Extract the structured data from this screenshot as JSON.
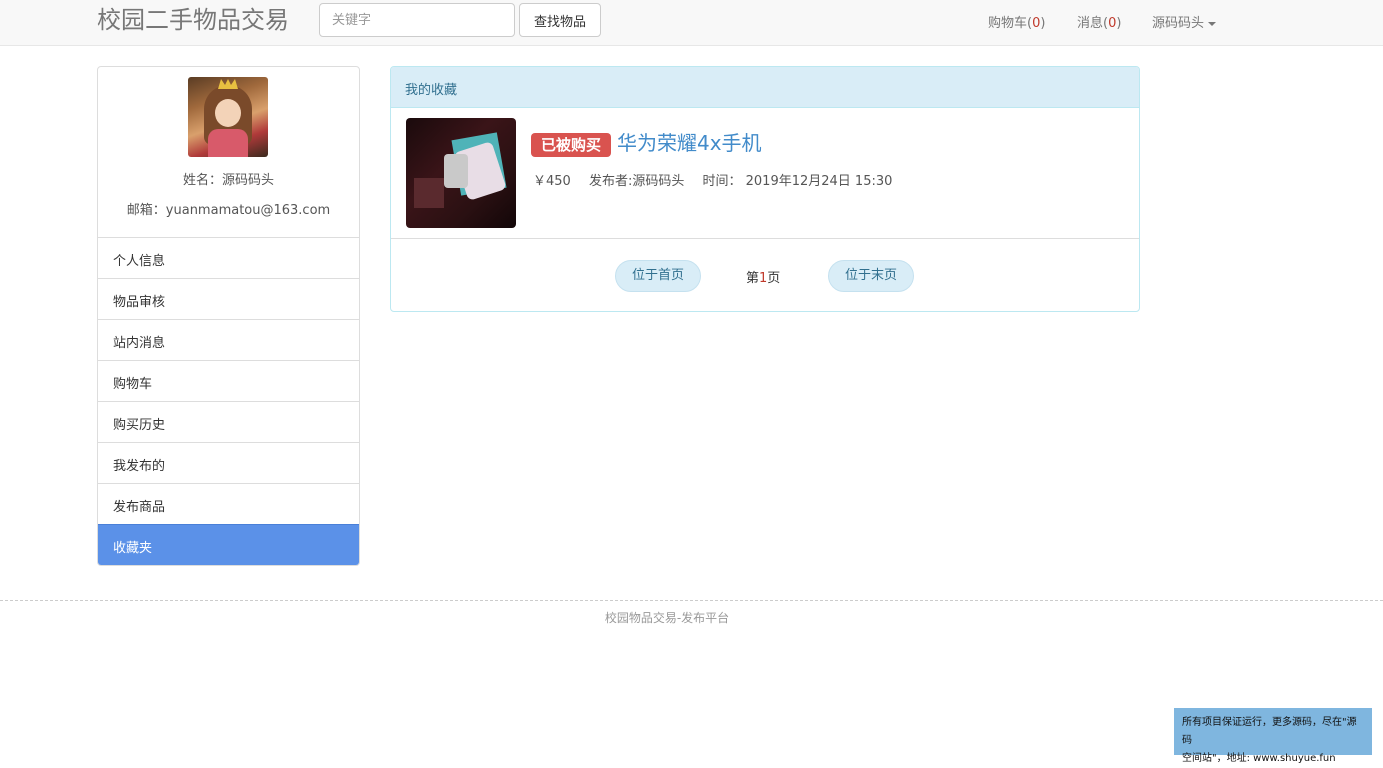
{
  "header": {
    "brand": "校园二手物品交易",
    "search_placeholder": "关键字",
    "search_button": "查找物品",
    "cart_label": "购物车(",
    "cart_count": "0",
    "cart_close": ")",
    "messages_label": "消息(",
    "messages_count": "0",
    "messages_close": ")",
    "user_menu": "源码码头"
  },
  "profile": {
    "name_line": "姓名：源码码头",
    "email_line": "邮箱：yuanmamatou@163.com"
  },
  "sidebar": {
    "items": [
      {
        "label": "个人信息"
      },
      {
        "label": "物品审核"
      },
      {
        "label": "站内消息"
      },
      {
        "label": "购物车"
      },
      {
        "label": "购买历史"
      },
      {
        "label": "我发布的"
      },
      {
        "label": "发布商品"
      },
      {
        "label": "收藏夹",
        "active": true
      }
    ]
  },
  "favorites": {
    "heading": "我的收藏",
    "items": [
      {
        "status": "已被购买",
        "title": "华为荣耀4x手机",
        "price": "￥450",
        "publisher": "发布者:源码码头",
        "time": "时间： 2019年12月24日 15:30"
      }
    ],
    "pagination": {
      "first": "位于首页",
      "last": "位于末页",
      "prefix": "第",
      "current": "1",
      "suffix": "页"
    }
  },
  "footer": {
    "text": "校园物品交易-发布平台"
  },
  "corner_ad": {
    "line1": "所有项目保证运行，更多源码，尽在\"源码",
    "line2": "空间站\"，地址: www.shuyue.fun"
  },
  "colors": {
    "active_menu": "#5b91e8",
    "sold_badge": "#d9534f",
    "panel_heading": "#d9edf7",
    "title_link": "#428bca"
  }
}
